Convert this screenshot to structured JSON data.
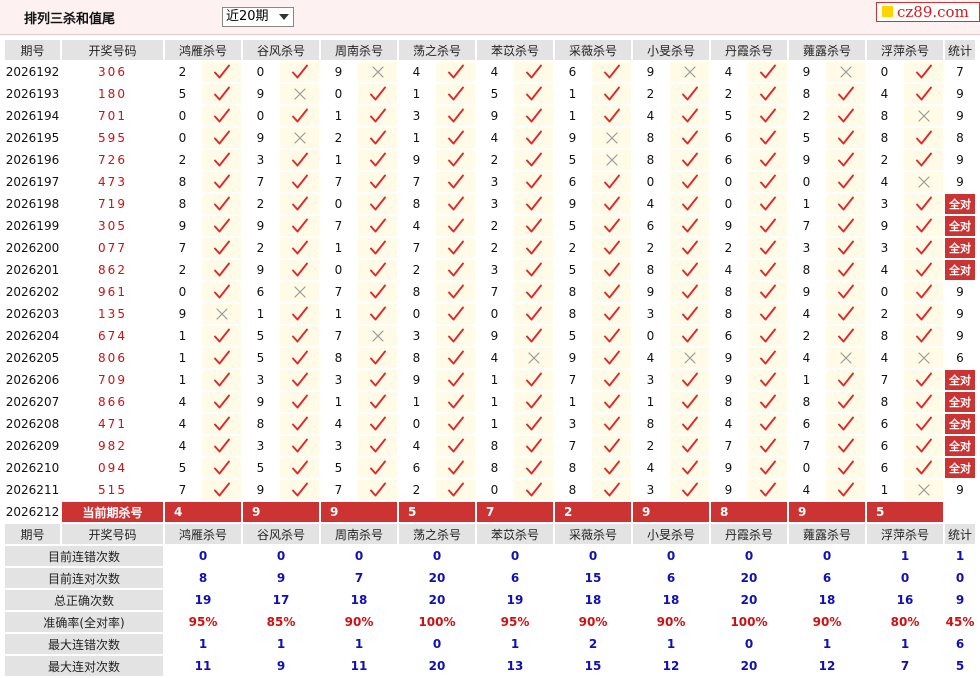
{
  "header": {
    "title": "排列三杀和值尾",
    "period_select": "近20期",
    "logo": "cz89.com"
  },
  "columns": [
    "期号",
    "开奖号码",
    "鸿雁杀号",
    "谷风杀号",
    "周南杀号",
    "荡之杀号",
    "苯苡杀号",
    "采薇杀号",
    "小旻杀号",
    "丹霞杀号",
    "蕹露杀号",
    "浮萍杀号",
    "统计"
  ],
  "experts": [
    "鸿雁杀号",
    "谷风杀号",
    "周南杀号",
    "荡之杀号",
    "苯苡杀号",
    "采薇杀号",
    "小旻杀号",
    "丹霞杀号",
    "蕹露杀号",
    "浮萍杀号"
  ],
  "all_correct_label": "全对",
  "rows": [
    {
      "period": "2026192",
      "number": "306",
      "kills": [
        2,
        0,
        9,
        4,
        4,
        6,
        9,
        4,
        9,
        0
      ],
      "marks": [
        1,
        1,
        0,
        1,
        1,
        1,
        0,
        1,
        0,
        1
      ],
      "stat": "7"
    },
    {
      "period": "2026193",
      "number": "180",
      "kills": [
        5,
        9,
        0,
        1,
        5,
        1,
        2,
        2,
        8,
        4
      ],
      "marks": [
        1,
        0,
        1,
        1,
        1,
        1,
        1,
        1,
        1,
        1
      ],
      "stat": "9"
    },
    {
      "period": "2026194",
      "number": "701",
      "kills": [
        0,
        0,
        1,
        3,
        9,
        1,
        4,
        5,
        2,
        8
      ],
      "marks": [
        1,
        1,
        1,
        1,
        1,
        1,
        1,
        1,
        1,
        0
      ],
      "stat": "9"
    },
    {
      "period": "2026195",
      "number": "595",
      "kills": [
        0,
        9,
        2,
        1,
        4,
        9,
        8,
        6,
        5,
        8
      ],
      "marks": [
        1,
        0,
        1,
        1,
        1,
        0,
        1,
        1,
        1,
        1
      ],
      "stat": "8"
    },
    {
      "period": "2026196",
      "number": "726",
      "kills": [
        2,
        3,
        1,
        9,
        2,
        5,
        8,
        6,
        9,
        2
      ],
      "marks": [
        1,
        1,
        1,
        1,
        1,
        0,
        1,
        1,
        1,
        1
      ],
      "stat": "9"
    },
    {
      "period": "2026197",
      "number": "473",
      "kills": [
        8,
        7,
        7,
        7,
        3,
        6,
        0,
        0,
        0,
        4
      ],
      "marks": [
        1,
        1,
        1,
        1,
        1,
        1,
        1,
        1,
        1,
        0
      ],
      "stat": "9"
    },
    {
      "period": "2026198",
      "number": "719",
      "kills": [
        8,
        2,
        0,
        8,
        3,
        9,
        4,
        0,
        1,
        3
      ],
      "marks": [
        1,
        1,
        1,
        1,
        1,
        1,
        1,
        1,
        1,
        1
      ],
      "stat": "全对"
    },
    {
      "period": "2026199",
      "number": "305",
      "kills": [
        9,
        9,
        7,
        4,
        2,
        5,
        6,
        9,
        7,
        9
      ],
      "marks": [
        1,
        1,
        1,
        1,
        1,
        1,
        1,
        1,
        1,
        1
      ],
      "stat": "全对"
    },
    {
      "period": "2026200",
      "number": "077",
      "kills": [
        7,
        2,
        1,
        7,
        2,
        2,
        2,
        2,
        3,
        3
      ],
      "marks": [
        1,
        1,
        1,
        1,
        1,
        1,
        1,
        1,
        1,
        1
      ],
      "stat": "全对"
    },
    {
      "period": "2026201",
      "number": "862",
      "kills": [
        2,
        9,
        0,
        2,
        3,
        5,
        8,
        4,
        8,
        4
      ],
      "marks": [
        1,
        1,
        1,
        1,
        1,
        1,
        1,
        1,
        1,
        1
      ],
      "stat": "全对"
    },
    {
      "period": "2026202",
      "number": "961",
      "kills": [
        0,
        6,
        7,
        8,
        7,
        8,
        9,
        8,
        9,
        0
      ],
      "marks": [
        1,
        0,
        1,
        1,
        1,
        1,
        1,
        1,
        1,
        1
      ],
      "stat": "9"
    },
    {
      "period": "2026203",
      "number": "135",
      "kills": [
        9,
        1,
        1,
        0,
        0,
        8,
        3,
        8,
        4,
        2
      ],
      "marks": [
        0,
        1,
        1,
        1,
        1,
        1,
        1,
        1,
        1,
        1
      ],
      "stat": "9"
    },
    {
      "period": "2026204",
      "number": "674",
      "kills": [
        1,
        5,
        7,
        3,
        9,
        5,
        0,
        6,
        2,
        8
      ],
      "marks": [
        1,
        1,
        0,
        1,
        1,
        1,
        1,
        1,
        1,
        1
      ],
      "stat": "9"
    },
    {
      "period": "2026205",
      "number": "806",
      "kills": [
        1,
        5,
        8,
        8,
        4,
        9,
        4,
        9,
        4,
        4
      ],
      "marks": [
        1,
        1,
        1,
        1,
        0,
        1,
        0,
        1,
        0,
        0
      ],
      "stat": "6"
    },
    {
      "period": "2026206",
      "number": "709",
      "kills": [
        1,
        3,
        3,
        9,
        1,
        7,
        3,
        9,
        1,
        7
      ],
      "marks": [
        1,
        1,
        1,
        1,
        1,
        1,
        1,
        1,
        1,
        1
      ],
      "stat": "全对"
    },
    {
      "period": "2026207",
      "number": "866",
      "kills": [
        4,
        9,
        1,
        1,
        1,
        1,
        1,
        8,
        8,
        8
      ],
      "marks": [
        1,
        1,
        1,
        1,
        1,
        1,
        1,
        1,
        1,
        1
      ],
      "stat": "全对"
    },
    {
      "period": "2026208",
      "number": "471",
      "kills": [
        4,
        8,
        4,
        0,
        1,
        3,
        8,
        4,
        6,
        6
      ],
      "marks": [
        1,
        1,
        1,
        1,
        1,
        1,
        1,
        1,
        1,
        1
      ],
      "stat": "全对"
    },
    {
      "period": "2026209",
      "number": "982",
      "kills": [
        4,
        3,
        3,
        4,
        8,
        7,
        2,
        7,
        7,
        6
      ],
      "marks": [
        1,
        1,
        1,
        1,
        1,
        1,
        1,
        1,
        1,
        1
      ],
      "stat": "全对"
    },
    {
      "period": "2026210",
      "number": "094",
      "kills": [
        5,
        5,
        5,
        6,
        8,
        8,
        4,
        9,
        0,
        6
      ],
      "marks": [
        1,
        1,
        1,
        1,
        1,
        1,
        1,
        1,
        1,
        1
      ],
      "stat": "全对"
    },
    {
      "period": "2026211",
      "number": "515",
      "kills": [
        7,
        9,
        7,
        2,
        0,
        8,
        3,
        9,
        4,
        1
      ],
      "marks": [
        1,
        1,
        1,
        1,
        1,
        1,
        1,
        1,
        1,
        0
      ],
      "stat": "9"
    }
  ],
  "current": {
    "period": "2026212",
    "label": "当前期杀号",
    "kills": [
      4,
      9,
      9,
      5,
      7,
      2,
      9,
      8,
      9,
      5
    ]
  },
  "summary": [
    {
      "label": "目前连错次数",
      "values": [
        "0",
        "0",
        "0",
        "0",
        "0",
        "0",
        "0",
        "0",
        "0",
        "1"
      ],
      "stat": "1"
    },
    {
      "label": "目前连对次数",
      "values": [
        "8",
        "9",
        "7",
        "20",
        "6",
        "15",
        "6",
        "20",
        "6",
        "0"
      ],
      "stat": "0"
    },
    {
      "label": "总正确次数",
      "values": [
        "19",
        "17",
        "18",
        "20",
        "19",
        "18",
        "18",
        "20",
        "18",
        "16"
      ],
      "stat": "9"
    },
    {
      "label": "准确率(全对率)",
      "values": [
        "95%",
        "85%",
        "90%",
        "100%",
        "95%",
        "90%",
        "90%",
        "100%",
        "90%",
        "80%"
      ],
      "stat": "45%",
      "highlight": true
    },
    {
      "label": "最大连错次数",
      "values": [
        "1",
        "1",
        "1",
        "0",
        "1",
        "2",
        "1",
        "0",
        "1",
        "1"
      ],
      "stat": "6"
    },
    {
      "label": "最大连对次数",
      "values": [
        "11",
        "9",
        "11",
        "20",
        "13",
        "15",
        "12",
        "20",
        "12",
        "7"
      ],
      "stat": "5"
    }
  ],
  "colors": {
    "accent": "#cc3333",
    "check": "#e0282c",
    "cross": "#9a9a9a",
    "summary_value": "#1010b8",
    "rate": "#d01010"
  }
}
